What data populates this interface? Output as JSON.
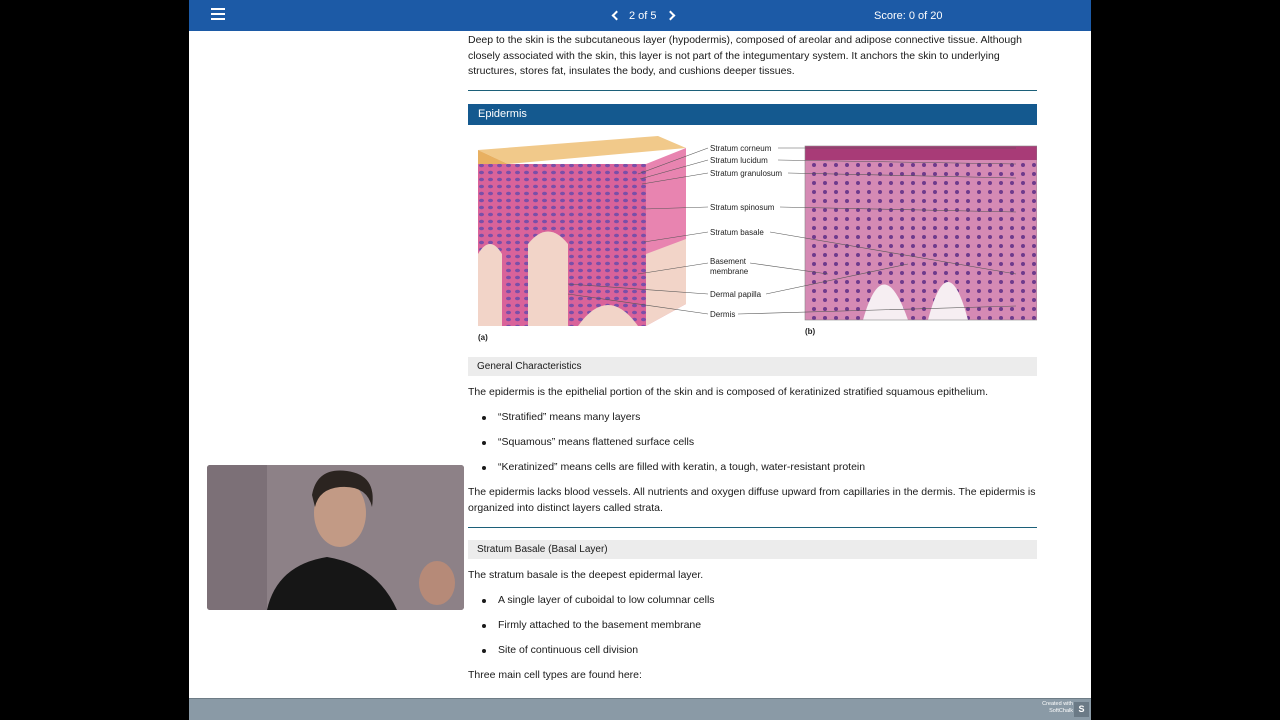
{
  "topbar": {
    "page_indicator": "2 of 5",
    "score": "Score: 0 of 20"
  },
  "content": {
    "intro": "Deep to the skin is the subcutaneous layer (hypodermis), composed of areolar and adipose connective tissue. Although closely associated with the skin, this layer is not part of the integumentary system. It anchors the skin to underlying structures, stores fat, insulates the body, and cushions deeper tissues.",
    "section_title": "Epidermis",
    "figure": {
      "labels": [
        "Stratum corneum",
        "Stratum lucidum",
        "Stratum granulosum",
        "Stratum spinosum",
        "Stratum basale",
        "Basement",
        "membrane",
        "Dermal papilla",
        "Dermis"
      ],
      "panel_a": "(a)",
      "panel_b": "(b)"
    },
    "general": {
      "heading": "General Characteristics",
      "intro": "The epidermis is the epithelial portion of the skin and is composed of keratinized stratified squamous epithelium.",
      "bullets": [
        "“Stratified” means many layers",
        "“Squamous” means flattened surface cells",
        "“Keratinized” means cells are filled with keratin, a tough, water-resistant protein"
      ],
      "outro": "The epidermis lacks blood vessels. All nutrients and oxygen diffuse upward from capillaries in the dermis. The epidermis is organized into distinct layers called strata."
    },
    "basale": {
      "heading": "Stratum Basale (Basal Layer)",
      "intro": "The stratum basale is the deepest epidermal layer.",
      "bullets": [
        "A single layer of cuboidal to low columnar cells",
        "Firmly attached to the basement membrane",
        "Site of continuous cell division"
      ],
      "outro": "Three main cell types are found here:"
    }
  },
  "footer": {
    "created_line1": "Created with",
    "created_line2": "SoftChalk",
    "logo_letter": "S"
  },
  "colors": {
    "topbar": "#1c5aa6",
    "section_header": "#14598f",
    "rule": "#1c6079",
    "subhead_bg": "#ececec"
  }
}
